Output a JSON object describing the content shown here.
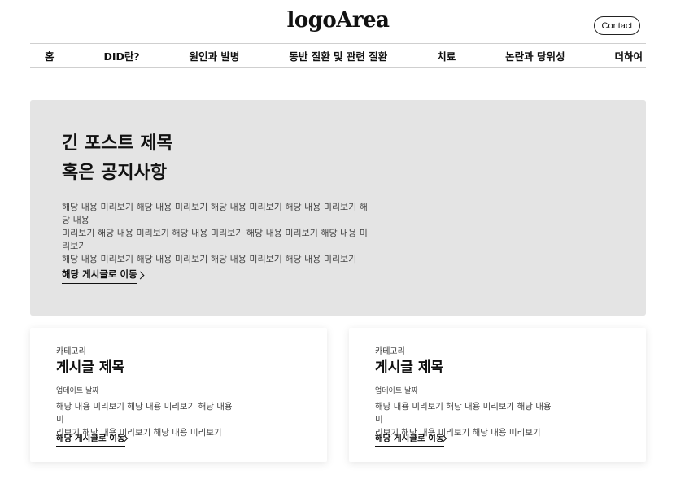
{
  "header": {
    "logo": "logoArea",
    "contact_label": "Contact"
  },
  "nav": {
    "items": [
      {
        "label": "홈"
      },
      {
        "label": "DID란?"
      },
      {
        "label": "원인과 발병"
      },
      {
        "label": "동반 질환 및 관련 질환"
      },
      {
        "label": "치료"
      },
      {
        "label": "논란과 당위성"
      },
      {
        "label": "더하여"
      }
    ]
  },
  "hero": {
    "title_line1": "긴 포스트 제목",
    "title_line2": "혹은 공지사항",
    "preview_lines": [
      "해당 내용 미리보기 해당 내용 미리보기 해당 내용 미리보기 해당 내용 미리보기 해당 내용",
      "미리보기 해당 내용 미리보기 해당 내용 미리보기 해당 내용 미리보기 해당 내용 미리보기",
      "해당 내용 미리보기 해당 내용 미리보기 해당 내용 미리보기 해당 내용 미리보기"
    ],
    "link_label": "해당 게시글로 이동"
  },
  "cards": [
    {
      "category": "카테고리",
      "title": "게시글 제목",
      "date": "업데이트 날짜",
      "preview_lines": [
        "해당 내용 미리보기 해당 내용 미리보기 해당 내용 미",
        "리보기 해당 내용 미리보기 해당 내용 미리보기"
      ],
      "link_label": "해당 게시글로 이동"
    },
    {
      "category": "카테고리",
      "title": "게시글 제목",
      "date": "업데이트 날짜",
      "preview_lines": [
        "해당 내용 미리보기 해당 내용 미리보기 해당 내용 미",
        "리보기 해당 내용 미리보기 해당 내용 미리보기"
      ],
      "link_label": "해당 게시글로 이동"
    }
  ],
  "colors": {
    "hero_background": "#e4e4e4",
    "text": "#111111",
    "muted_text": "#444444",
    "divider": "#cfcfcf"
  },
  "icons": {
    "link_arrow": "chevron-right-icon"
  }
}
